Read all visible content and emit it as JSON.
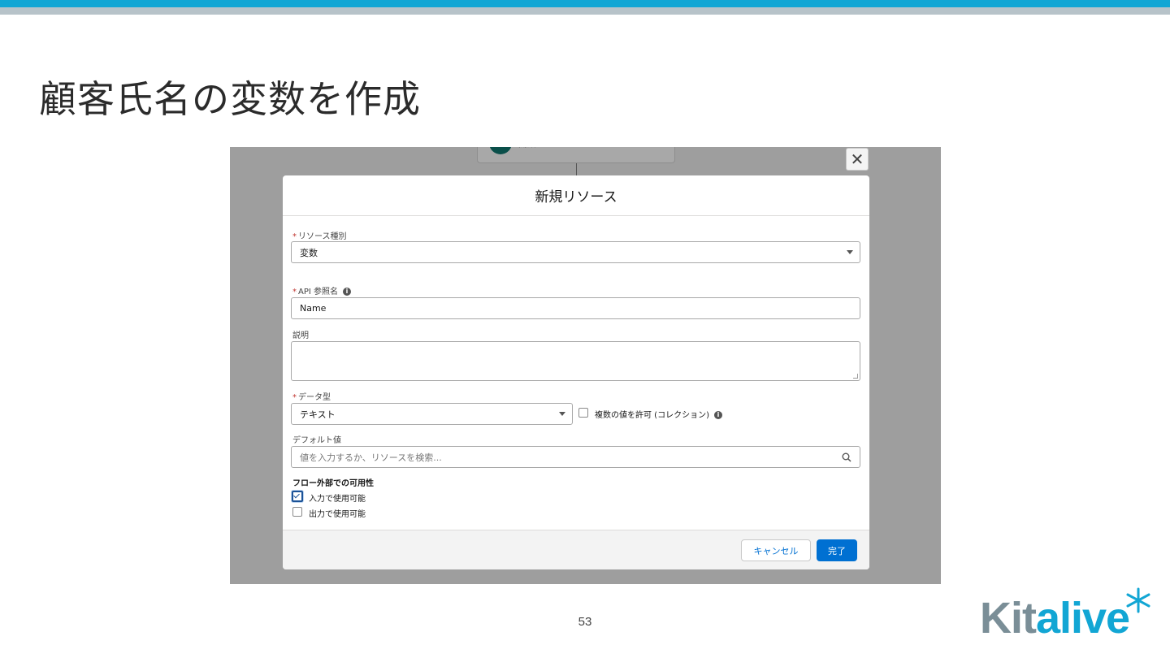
{
  "slide": {
    "title": "顧客氏名の変数を作成",
    "page_number": "53",
    "logo": {
      "part1": "Kit",
      "part2": "alive",
      "star": "*"
    }
  },
  "canvas": {
    "start_label": "開始"
  },
  "modal": {
    "title": "新規リソース",
    "resource_type": {
      "label": "リソース種別",
      "value": "変数"
    },
    "api_name": {
      "label": "API 参照名",
      "value": "Name"
    },
    "description": {
      "label": "説明",
      "value": ""
    },
    "data_type": {
      "label": "データ型",
      "value": "テキスト"
    },
    "allow_multiple": {
      "label": "複数の値を許可 (コレクション)",
      "checked": false
    },
    "default_value": {
      "label": "デフォルト値",
      "placeholder": "値を入力するか、リソースを検索..."
    },
    "availability": {
      "title": "フロー外部での可用性",
      "input": {
        "label": "入力で使用可能",
        "checked": true
      },
      "output": {
        "label": "出力で使用可能",
        "checked": false
      }
    },
    "buttons": {
      "cancel": "キャンセル",
      "done": "完了"
    },
    "required_mark": "*"
  },
  "colors": {
    "accent": "#12a6d4",
    "brand_button": "#0070d2",
    "overlay": "#9e9e9e"
  }
}
